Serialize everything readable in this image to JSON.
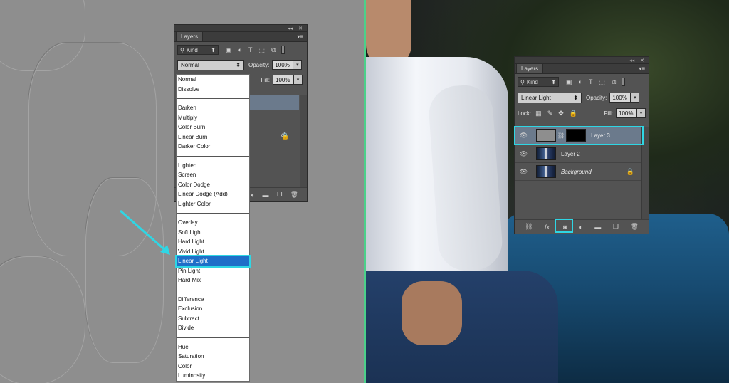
{
  "left_panel": {
    "tab_label": "Layers",
    "filter_kind": "Kind",
    "blend_mode": "Normal",
    "opacity_label": "Opacity:",
    "opacity_value": "100%",
    "fill_label": "Fill:",
    "fill_value": "100%"
  },
  "blend_menu": {
    "groups": [
      [
        "Normal",
        "Dissolve"
      ],
      [
        "Darken",
        "Multiply",
        "Color Burn",
        "Linear Burn",
        "Darker Color"
      ],
      [
        "Lighten",
        "Screen",
        "Color Dodge",
        "Linear Dodge (Add)",
        "Lighter Color"
      ],
      [
        "Overlay",
        "Soft Light",
        "Hard Light",
        "Vivid Light",
        "Linear Light",
        "Pin Light",
        "Hard Mix"
      ],
      [
        "Difference",
        "Exclusion",
        "Subtract",
        "Divide"
      ],
      [
        "Hue",
        "Saturation",
        "Color",
        "Luminosity"
      ]
    ],
    "selected": "Linear Light"
  },
  "right_panel": {
    "tab_label": "Layers",
    "filter_kind": "Kind",
    "blend_mode": "Linear Light",
    "opacity_label": "Opacity:",
    "opacity_value": "100%",
    "lock_label": "Lock:",
    "fill_label": "Fill:",
    "fill_value": "100%",
    "layers": [
      {
        "name": "Layer 3",
        "type": "gray-with-mask",
        "selected": true
      },
      {
        "name": "Layer 2",
        "type": "photo",
        "selected": false
      },
      {
        "name": "Background",
        "type": "photo",
        "selected": false,
        "locked": true
      }
    ]
  },
  "colors": {
    "highlight": "#2fd6e4",
    "divider": "#4cd08a",
    "selection_blue": "#1e6ec8",
    "panel_bg": "#535353"
  },
  "icons": [
    "eye-icon",
    "lock-icon",
    "link-icon",
    "fx-icon",
    "add-mask-icon",
    "adjustment-icon",
    "folder-icon",
    "new-layer-icon",
    "trash-icon"
  ]
}
